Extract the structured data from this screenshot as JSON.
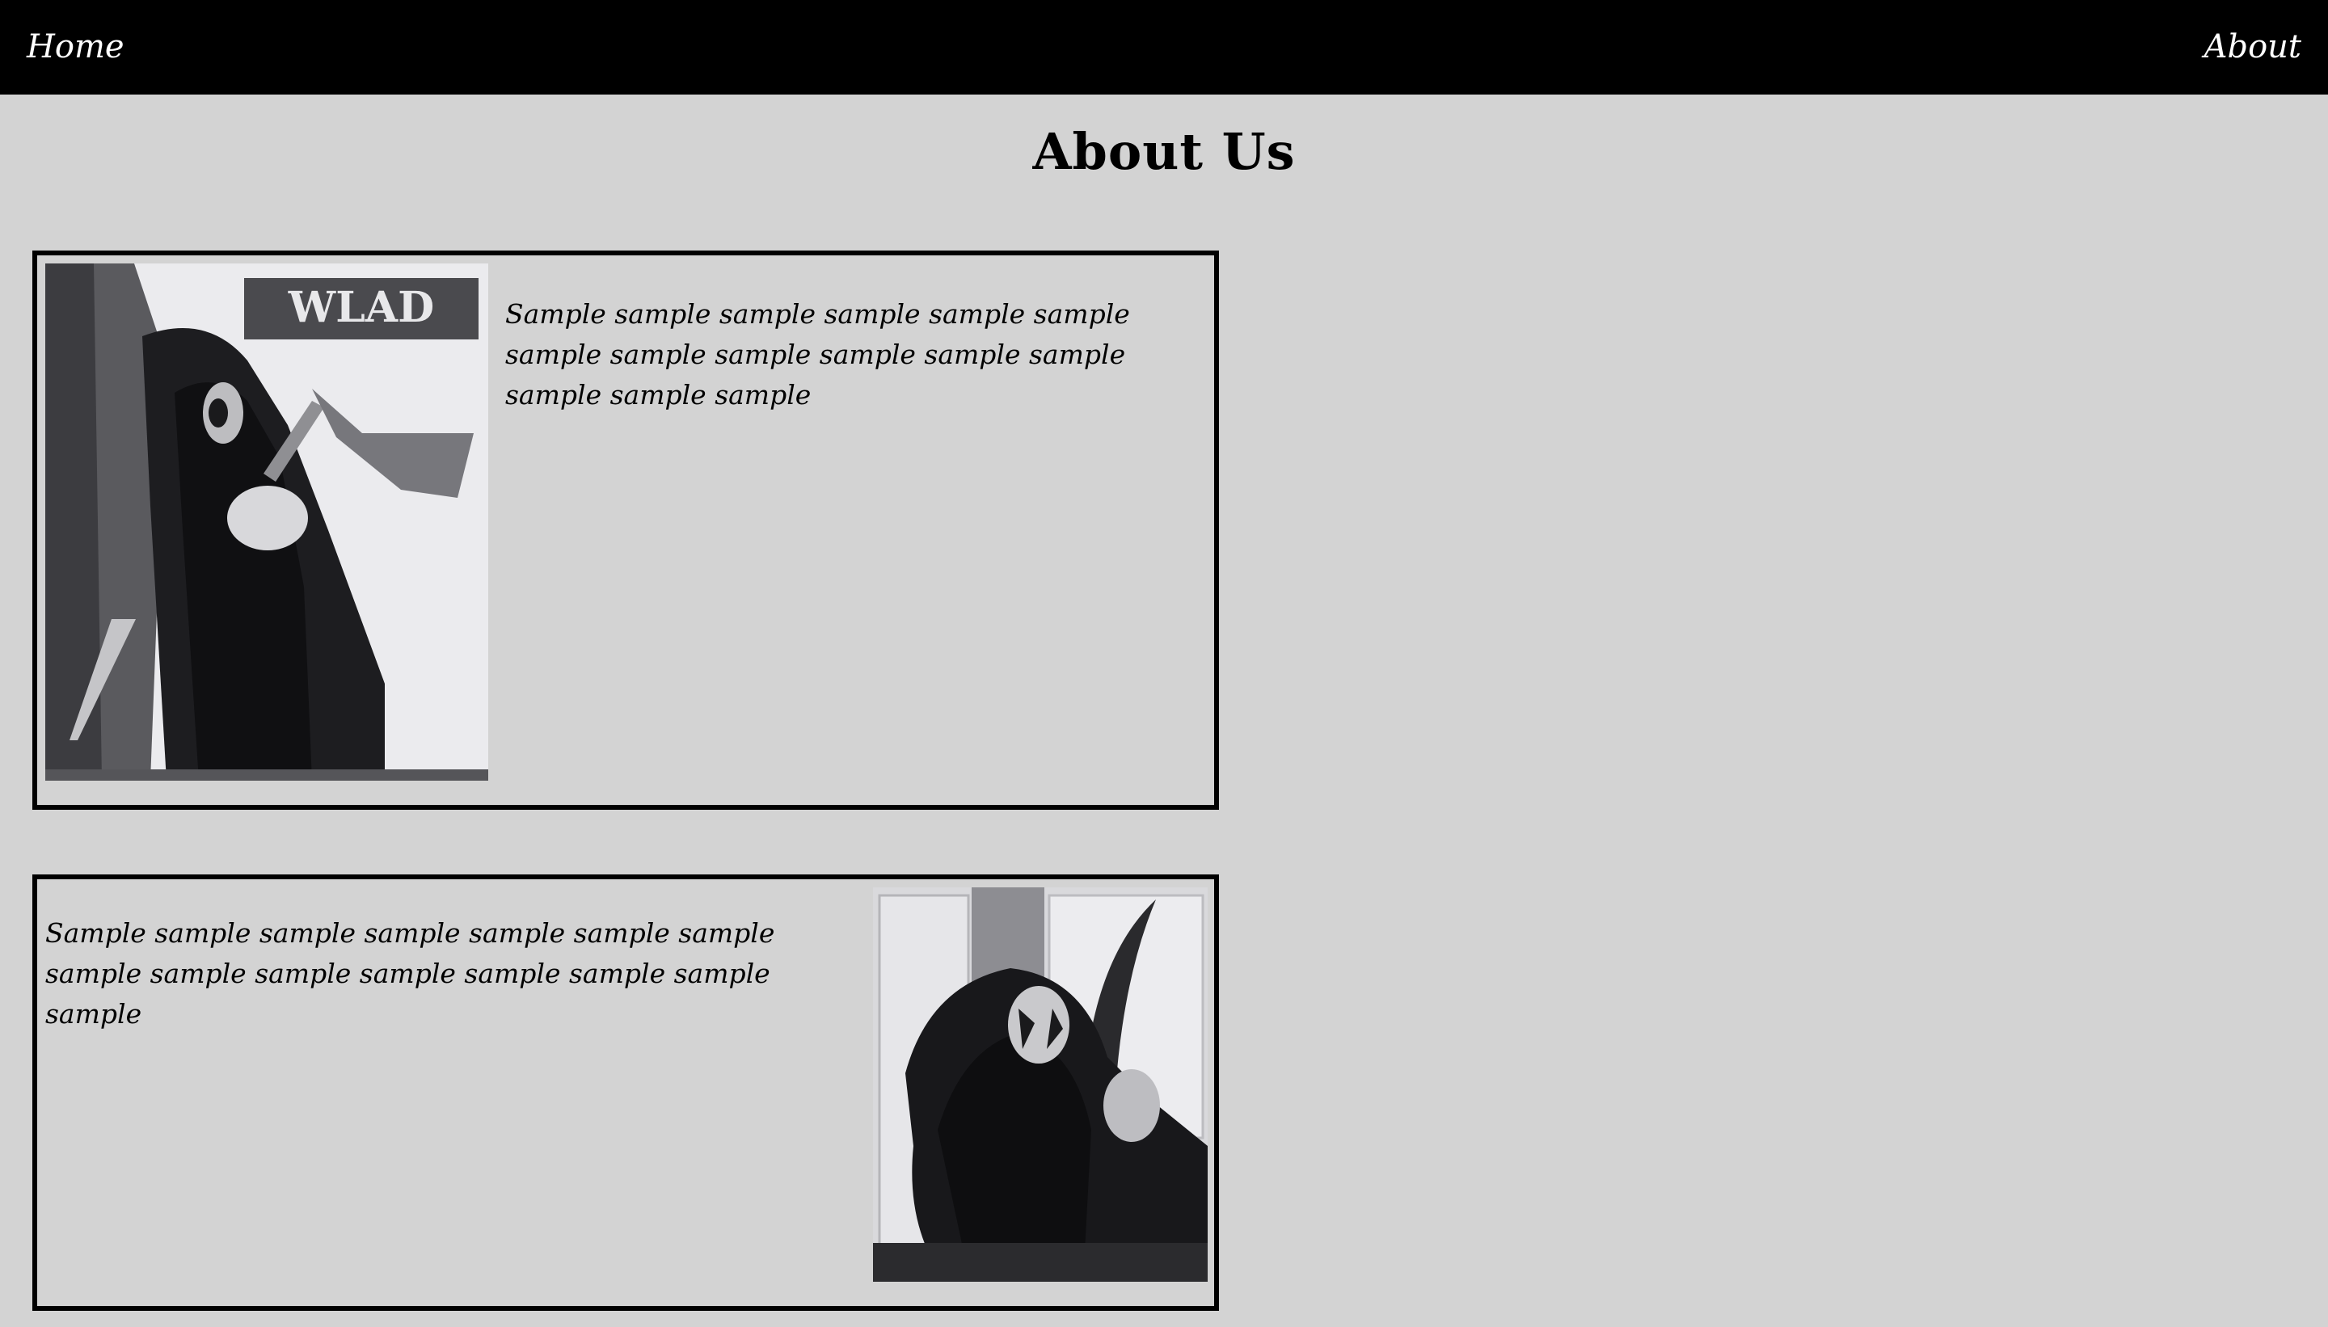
{
  "nav": {
    "home_label": "Home",
    "about_label": "About"
  },
  "page": {
    "title": "About Us"
  },
  "sections": [
    {
      "text": "Sample sample sample sample sample sample sample sample sample sample sample sample sample sample sample",
      "image_logo_text": "WLAD"
    },
    {
      "text": "Sample sample sample sample sample sample sample sample sample sample sample sample sample sample sample"
    }
  ],
  "colors": {
    "navbar_bg": "#000000",
    "page_bg": "#d3d3d3",
    "text": "#000000",
    "nav_text": "#ffffff",
    "border": "#000000"
  }
}
